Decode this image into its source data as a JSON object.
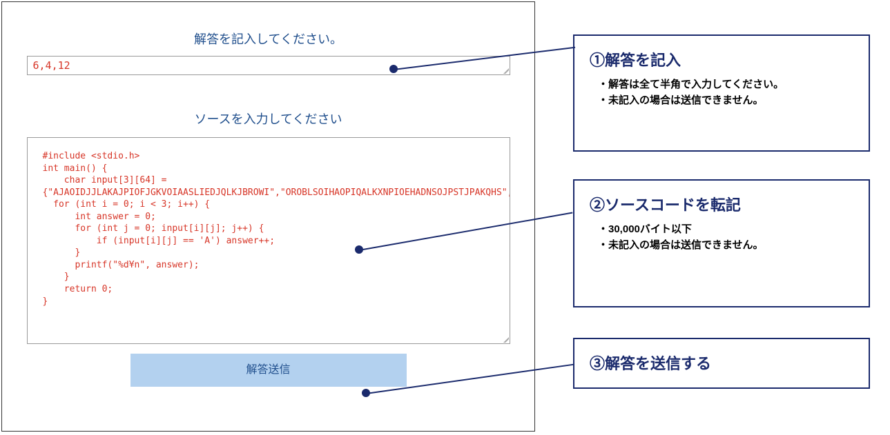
{
  "answer": {
    "label": "解答を記入してください。",
    "value": "6,4,12"
  },
  "source": {
    "label": "ソースを入力してください",
    "code": "#include <stdio.h>\nint main() {\n    char input[3][64] =\n{\"AJAOIDJJLAKAJPIOFJGKVOIAASLIEDJQLKJBROWI\",\"OROBLSOIHAOPIQALKXNPIOEHADNSOJPSTJPAKQHS\",\"AAIQNSSKLISJAAOAIJALKAMNOAZIJAKOWAIWHWAA\"};\n  for (int i = 0; i < 3; i++) {\n      int answer = 0;\n      for (int j = 0; input[i][j]; j++) {\n          if (input[i][j] == 'A') answer++;\n      }\n      printf(\"%d¥n\", answer);\n    }\n    return 0;\n}"
  },
  "submit": {
    "label": "解答送信"
  },
  "callouts": {
    "c1": {
      "title": "①解答を記入",
      "note1": "・解答は全て半角で入力してください。",
      "note2": "・未記入の場合は送信できません。"
    },
    "c2": {
      "title": "②ソースコードを転記",
      "note1": "・30,000バイト以下",
      "note2": "・未記入の場合は送信できません。"
    },
    "c3": {
      "title": "③解答を送信する"
    }
  }
}
